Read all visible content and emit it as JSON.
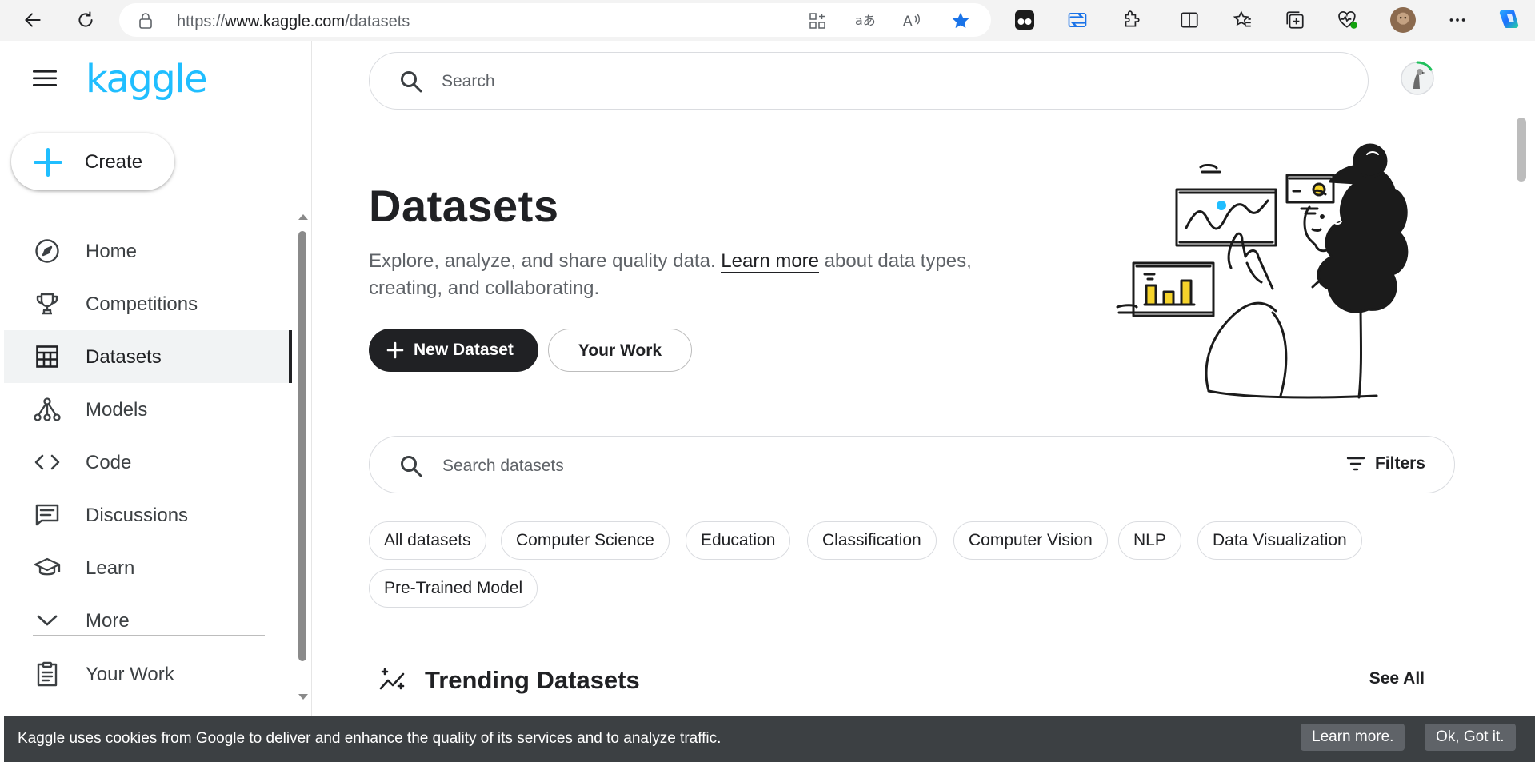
{
  "browser": {
    "url_prefix": "https://",
    "url_host": "www.kaggle.com",
    "url_path": "/datasets",
    "accent_color": "#1a73e8"
  },
  "sidebar": {
    "logo": "kaggle",
    "logo_color": "#20beff",
    "create_label": "Create",
    "items": [
      {
        "label": "Home",
        "icon": "compass-icon"
      },
      {
        "label": "Competitions",
        "icon": "trophy-icon"
      },
      {
        "label": "Datasets",
        "icon": "table-icon",
        "active": true
      },
      {
        "label": "Models",
        "icon": "models-icon"
      },
      {
        "label": "Code",
        "icon": "code-icon"
      },
      {
        "label": "Discussions",
        "icon": "comments-icon"
      },
      {
        "label": "Learn",
        "icon": "graduation-cap-icon"
      },
      {
        "label": "More",
        "icon": "chevron-down-icon"
      }
    ],
    "your_work": {
      "label": "Your Work",
      "icon": "clipboard-icon"
    }
  },
  "header": {
    "search_placeholder": "Search"
  },
  "hero": {
    "title": "Datasets",
    "desc_before": "Explore, analyze, and share quality data. ",
    "desc_link": "Learn more",
    "desc_after": " about data types, creating, and collaborating.",
    "new_dataset_label": "New Dataset",
    "your_work_label": "Your Work"
  },
  "dataset_search": {
    "placeholder": "Search datasets",
    "filters_label": "Filters"
  },
  "chips": [
    "All datasets",
    "Computer Science",
    "Education",
    "Classification",
    "Computer Vision",
    "NLP",
    "Data Visualization",
    "Pre-Trained Model"
  ],
  "trending": {
    "title": "Trending Datasets",
    "see_all": "See All"
  },
  "cookie": {
    "message": "Kaggle uses cookies from Google to deliver and enhance the quality of its services and to analyze traffic.",
    "learn_more": "Learn more.",
    "ok": "Ok, Got it."
  }
}
